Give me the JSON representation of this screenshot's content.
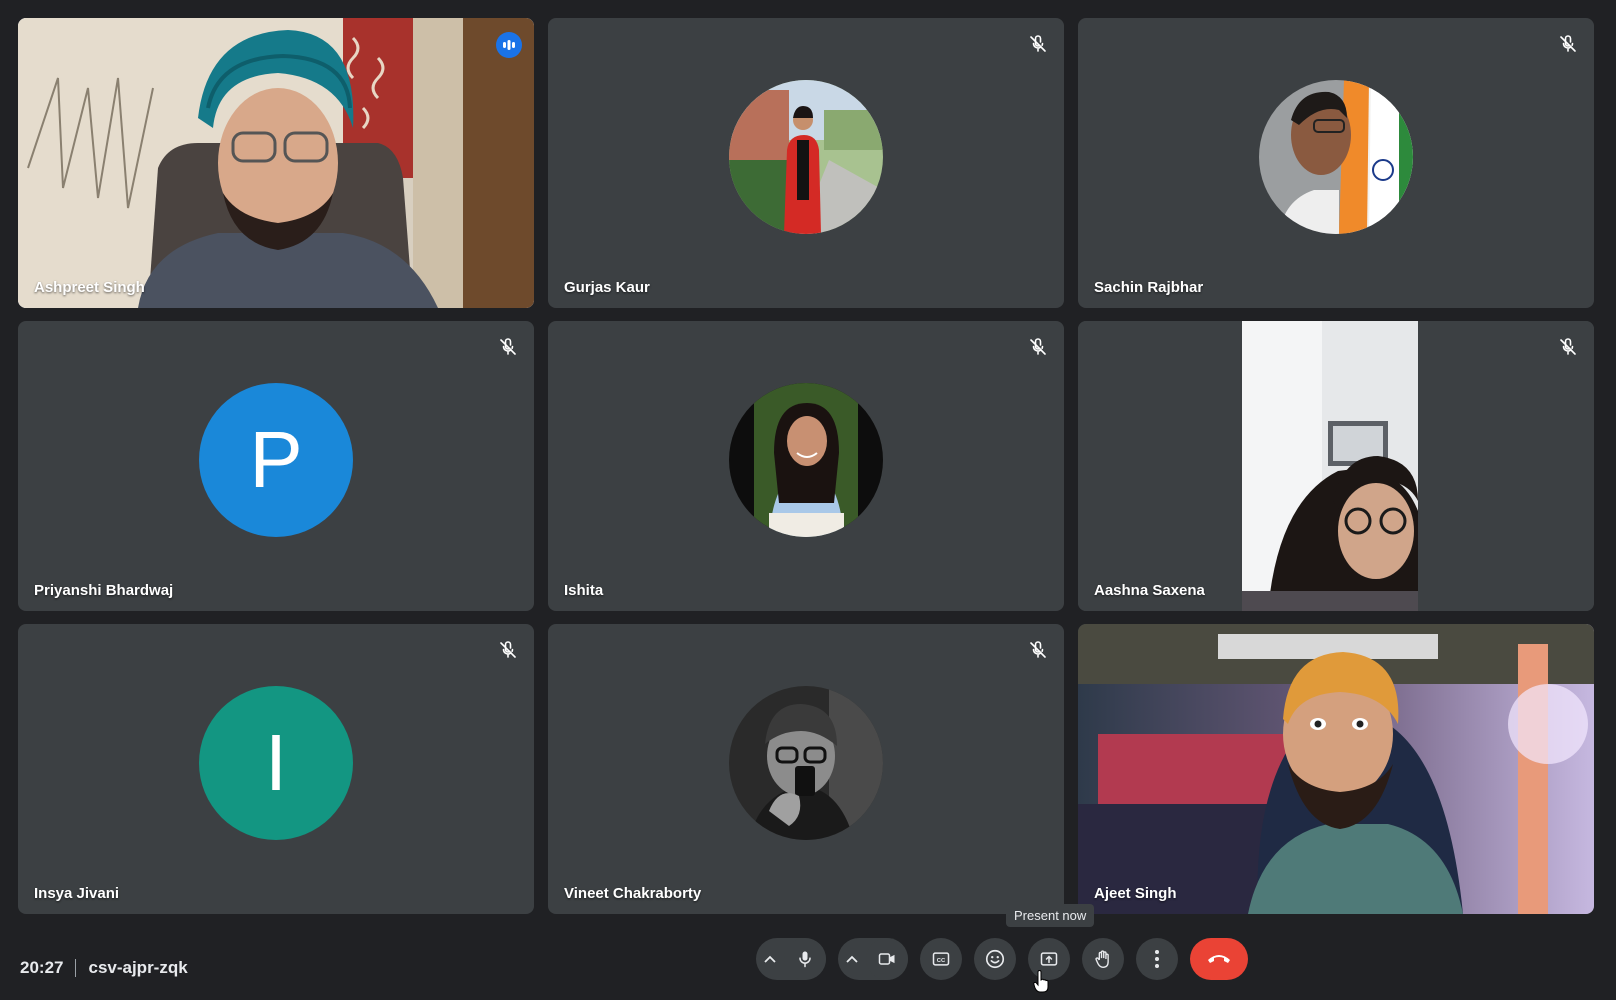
{
  "participants": [
    {
      "name": "Ashpreet Singh",
      "type": "video",
      "speaking": true
    },
    {
      "name": "Gurjas Kaur",
      "type": "photo",
      "muted": true
    },
    {
      "name": "Sachin Rajbhar",
      "type": "photo",
      "muted": true
    },
    {
      "name": "Priyanshi Bhardwaj",
      "type": "letter",
      "letter": "P",
      "color": "#1a88d9",
      "muted": true
    },
    {
      "name": "Ishita",
      "type": "photo",
      "muted": true
    },
    {
      "name": "Aashna Saxena",
      "type": "video",
      "muted": true
    },
    {
      "name": "Insya Jivani",
      "type": "letter",
      "letter": "I",
      "color": "#139682",
      "muted": true
    },
    {
      "name": "Vineet Chakraborty",
      "type": "photo",
      "muted": true
    },
    {
      "name": "Ajeet Singh",
      "type": "video"
    }
  ],
  "meeting": {
    "time": "20:27",
    "code": "csv-ajpr-zqk"
  },
  "tooltip": {
    "present_now": "Present now"
  },
  "colors": {
    "background": "#202124",
    "tile": "#3c4043",
    "active_border": "#8ab4f8",
    "end_call": "#ea4335",
    "speaking_indicator": "#1a73e8"
  },
  "icons": {
    "mute": "mic-off-icon",
    "speaking": "audio-level-icon",
    "mic": "mic-icon",
    "camera": "videocam-icon",
    "captions": "closed-captions-icon",
    "emoji": "emoji-icon",
    "present": "present-screen-icon",
    "hand": "raise-hand-icon",
    "more": "more-vert-icon",
    "end": "call-end-icon"
  }
}
